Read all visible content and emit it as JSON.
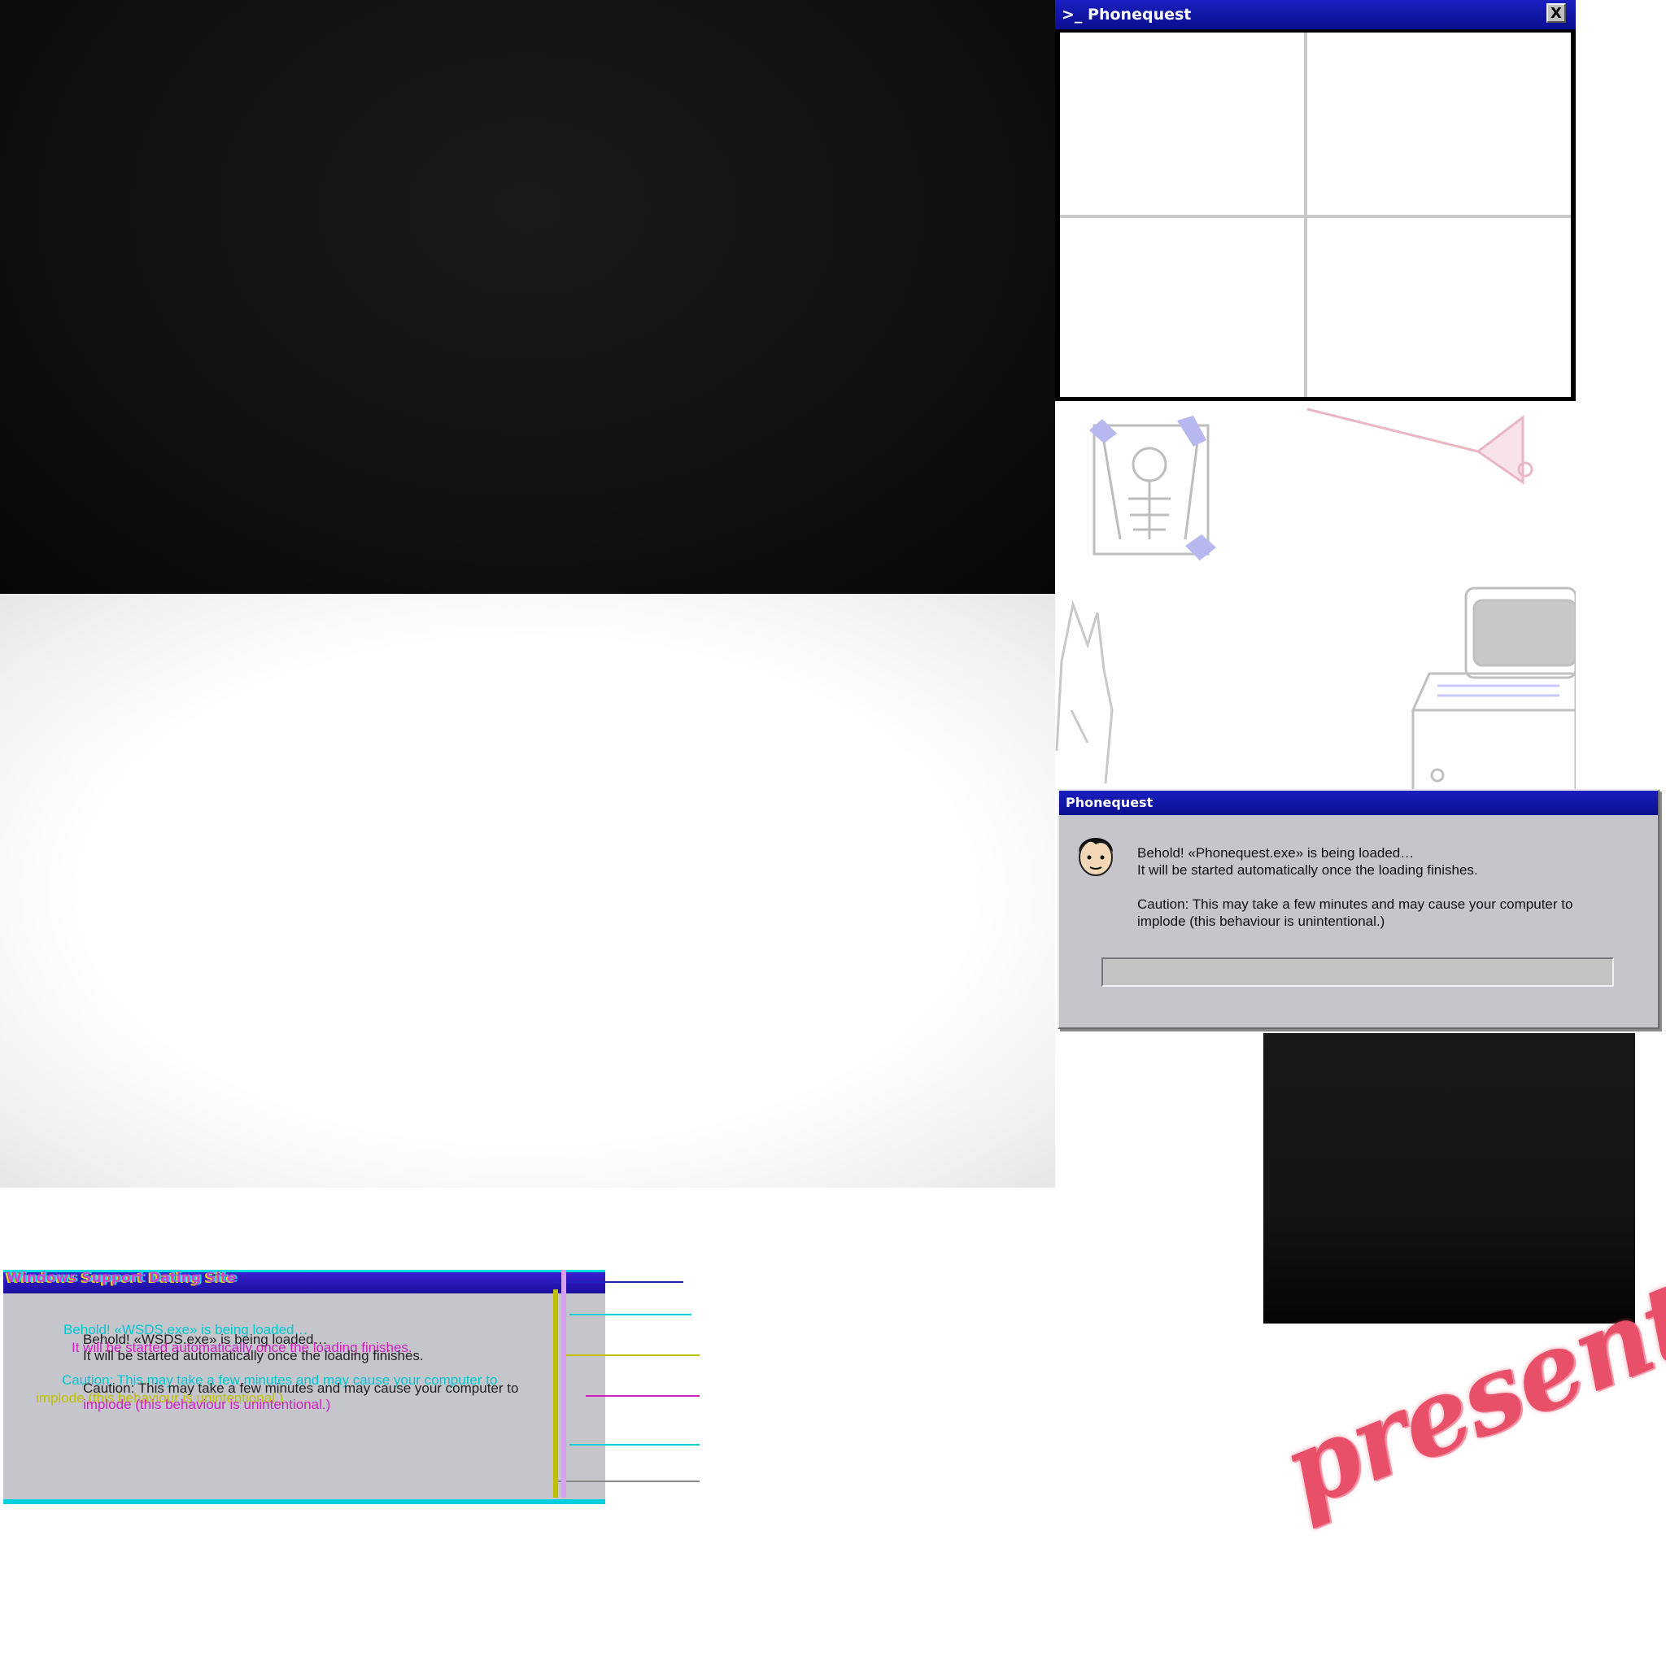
{
  "terminal": {
    "title": "Phonequest",
    "prompt_prefix": ">_",
    "close_label": "X"
  },
  "dialog": {
    "title": "Phonequest",
    "line1": "Behold! «Phonequest.exe» is being loaded…",
    "line2": "It will be started automatically once the loading finishes.",
    "line3": "Caution: This may take a few minutes and may cause your computer to",
    "line4": "implode (this behaviour is unintentional.)",
    "progress": 0
  },
  "glitch_dialog": {
    "title": "Windows Support Dating Site",
    "line1": "Behold! «WSDS.exe» is being loaded…",
    "line2": "It will be started automatically once the loading finishes.",
    "line3": "Caution: This may take a few minutes and may cause your computer to",
    "line4": "implode (this behaviour is unintentional.)"
  },
  "presents_text": "presents",
  "colors": {
    "titlebar": "#0a0e8e",
    "dialog_bg": "#c4c6cc",
    "presents": "#e8506a"
  }
}
